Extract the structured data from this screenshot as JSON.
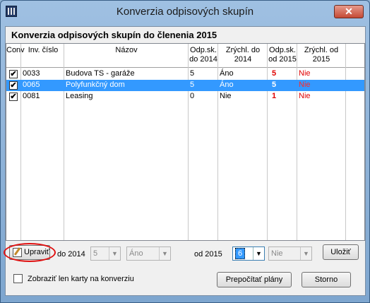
{
  "window": {
    "title": "Konverzia odpisových skupín",
    "close_glyph": "✕",
    "heading": "Konverzia odpisových skupín do členenia 2015"
  },
  "grid": {
    "columns": [
      {
        "key": "conv",
        "label_lines": [
          "Conv"
        ]
      },
      {
        "key": "inv",
        "label_lines": [
          "Inv. číslo"
        ]
      },
      {
        "key": "nazov",
        "label_lines": [
          "Názov"
        ]
      },
      {
        "key": "odp2014",
        "label_lines": [
          "Odp.sk.",
          "do 2014"
        ]
      },
      {
        "key": "zr2014",
        "label_lines": [
          "Zrýchl. do",
          "2014"
        ]
      },
      {
        "key": "odp2015",
        "label_lines": [
          "Odp.sk.",
          "od 2015"
        ]
      },
      {
        "key": "zr2015",
        "label_lines": [
          "Zrýchl. od",
          "2015"
        ]
      }
    ],
    "rows": [
      {
        "checked": true,
        "inv": "0033",
        "nazov": "Budova TS - garáže",
        "odp2014": "5",
        "zr2014": "Áno",
        "odp2015": "5",
        "zr2015": "Nie",
        "selected": false
      },
      {
        "checked": true,
        "inv": "0065",
        "nazov": "Polyfunkčný dom",
        "odp2014": "5",
        "zr2014": "Áno",
        "odp2015": "5",
        "zr2015": "Nie",
        "selected": true
      },
      {
        "checked": true,
        "inv": "0081",
        "nazov": "Leasing",
        "odp2014": "0",
        "zr2014": "Nie",
        "odp2015": "1",
        "zr2015": "Nie",
        "selected": false
      }
    ],
    "check_glyph": "✔",
    "accent_red": "#e00000",
    "selection_blue": "#3399ff"
  },
  "edit": {
    "upravit_label": "Upraviť",
    "do2014_label": "do 2014",
    "do2014_group": "5",
    "do2014_accel": "Áno",
    "od2015_label": "od 2015",
    "od2015_group": "6",
    "od2015_accel": "Nie",
    "ulozit_label": "Uložiť",
    "dropdown_glyph": "▼"
  },
  "bottom": {
    "only_conversion_label": "Zobraziť len karty na konverziu",
    "prepocitat_label": "Prepočítať plány",
    "storno_label": "Storno"
  }
}
